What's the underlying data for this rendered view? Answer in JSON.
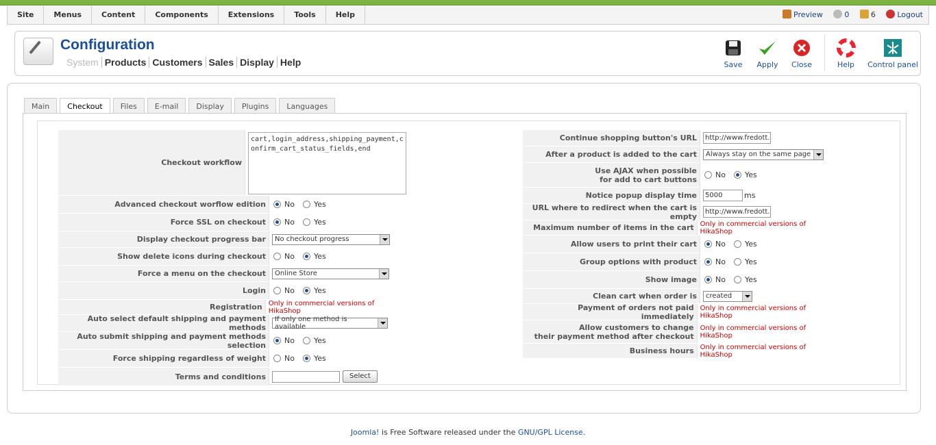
{
  "menubar": {
    "items": [
      "Site",
      "Menus",
      "Content",
      "Components",
      "Extensions",
      "Tools",
      "Help"
    ],
    "preview": "Preview",
    "messages_count": "0",
    "users_count": "6",
    "logout": "Logout"
  },
  "header": {
    "title": "Configuration",
    "subnav": [
      "System",
      "Products",
      "Customers",
      "Sales",
      "Display",
      "Help"
    ]
  },
  "toolbar": {
    "save": "Save",
    "apply": "Apply",
    "close": "Close",
    "help": "Help",
    "control_panel": "Control panel"
  },
  "tabs": [
    "Main",
    "Checkout",
    "Files",
    "E-mail",
    "Display",
    "Plugins",
    "Languages"
  ],
  "left": {
    "checkout_workflow_label": "Checkout workflow",
    "checkout_workflow_value": "cart,login_address,shipping_payment,confirm_cart_status_fields,end",
    "advanced_label": "Advanced checkout worflow edition",
    "force_ssl_label": "Force SSL on checkout",
    "progress_label": "Display checkout progress bar",
    "progress_value": "No checkout progress",
    "delete_icons_label": "Show delete icons during checkout",
    "force_menu_label": "Force a menu on the checkout",
    "force_menu_value": "Online Store",
    "login_label": "Login",
    "registration_label": "Registration",
    "registration_value": "Only in commercial versions of HikaShop",
    "auto_select_label": "Auto select default shipping and payment methods",
    "auto_select_value": "If only one method is available",
    "auto_submit_label": "Auto submit shipping and payment methods selection",
    "force_shipping_label": "Force shipping regardless of weight",
    "terms_label": "Terms and conditions",
    "select_button": "Select"
  },
  "right": {
    "continue_label": "Continue shopping button's URL",
    "continue_value": "http://www.fredott.cc",
    "after_added_label": "After a product is added to the cart",
    "after_added_value": "Always stay on the same page",
    "ajax_label_1": "Use AJAX when possible",
    "ajax_label_2": "for add to cart buttons",
    "popup_label": "Notice popup display time",
    "popup_value": "5000",
    "popup_unit": "ms",
    "redirect_label": "URL where to redirect when the cart is empty",
    "redirect_value": "http://www.fredott.cc",
    "max_items_label": "Maximum number of items in the cart",
    "max_items_value": "Only in commercial versions of HikaShop",
    "print_label": "Allow users to print their cart",
    "group_label": "Group options with product",
    "show_image_label": "Show image",
    "clean_label": "Clean cart when order is",
    "clean_value": "created",
    "payment_not_paid_label": "Payment of orders not paid immediately",
    "payment_not_paid_value": "Only in commercial versions of HikaShop",
    "allow_change_label_1": "Allow customers to change",
    "allow_change_label_2": "their payment method after checkout",
    "allow_change_value": "Only in commercial versions of HikaShop",
    "business_label": "Business hours",
    "business_value": "Only in commercial versions of HikaShop"
  },
  "radio": {
    "no": "No",
    "yes": "Yes"
  },
  "footer": {
    "joomla": "Joomla!",
    "text": " is Free Software released under the ",
    "license": "GNU/GPL License",
    "end": "."
  }
}
